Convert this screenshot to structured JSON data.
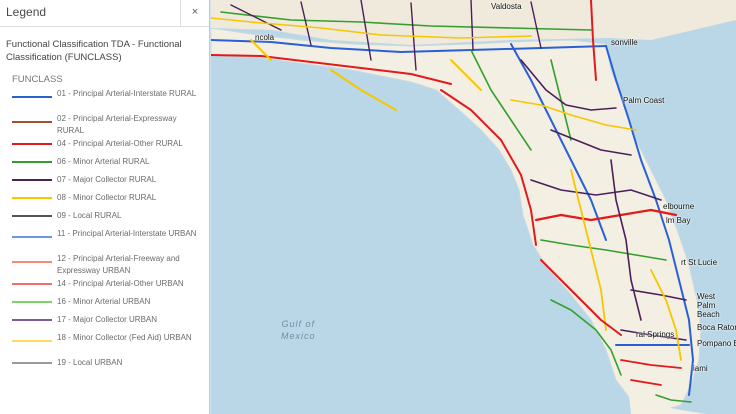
{
  "legend": {
    "title": "Legend",
    "close_symbol": "×",
    "layer_title": "Functional Classification TDA - Functional Classification (FUNCLASS)",
    "field_name": "FUNCLASS",
    "items": [
      {
        "label": "01 - Principal Arterial-Interstate RURAL",
        "color": "#2a5fd6",
        "lines": 2
      },
      {
        "label": "02 - Principal Arterial-Expressway RURAL",
        "color": "#a0522d",
        "lines": 2
      },
      {
        "label": "04 - Principal Arterial-Other RURAL",
        "color": "#e31a1c",
        "lines": 1
      },
      {
        "label": "06 - Minor Arterial RURAL",
        "color": "#33a02c",
        "lines": 1
      },
      {
        "label": "07 - Major Collector RURAL",
        "color": "#4b1f5c",
        "lines": 1
      },
      {
        "label": "08 - Minor Collector RURAL",
        "color": "#f7c600",
        "lines": 1
      },
      {
        "label": "09 - Local RURAL",
        "color": "#555555",
        "lines": 1
      },
      {
        "label": "11 - Principal Arterial-Interstate URBAN",
        "color": "#6f95ea",
        "lines": 2
      },
      {
        "label": "12 - Principal Arterial-Freeway and Expressway URBAN",
        "color": "#f28b7a",
        "lines": 2
      },
      {
        "label": "14 - Principal Arterial-Other URBAN",
        "color": "#f56c6c",
        "lines": 1
      },
      {
        "label": "16 - Minor Arterial URBAN",
        "color": "#7ccf6b",
        "lines": 1
      },
      {
        "label": "17 - Major Collector URBAN",
        "color": "#7d5a96",
        "lines": 1
      },
      {
        "label": "18 - Minor Collector (Fed Aid) URBAN",
        "color": "#fbdc5c",
        "lines": 2
      },
      {
        "label": "19 - Local URBAN",
        "color": "#9a9a9a",
        "lines": 1
      }
    ]
  },
  "map": {
    "land_color": "#f3efe3",
    "water_color": "#b9d7e6",
    "water_label": "Gulf of Mexico",
    "cities": [
      {
        "id": "valdosta",
        "name": "Valdosta"
      },
      {
        "id": "pensacola",
        "name": "ncola"
      },
      {
        "id": "jacksonville",
        "name": "sonville"
      },
      {
        "id": "palmcoast",
        "name": "Palm Coast"
      },
      {
        "id": "melbourne",
        "name": "elbourne"
      },
      {
        "id": "palmbay",
        "name": "lm Bay"
      },
      {
        "id": "portstlucie",
        "name": "rt St Lucie"
      },
      {
        "id": "westpalm",
        "name": "West Palm Beach"
      },
      {
        "id": "bocaraton",
        "name": "Boca Raton"
      },
      {
        "id": "coralsprings",
        "name": "ral Springs"
      },
      {
        "id": "pompano",
        "name": "Pompano B"
      },
      {
        "id": "miami",
        "name": "iami"
      }
    ]
  }
}
